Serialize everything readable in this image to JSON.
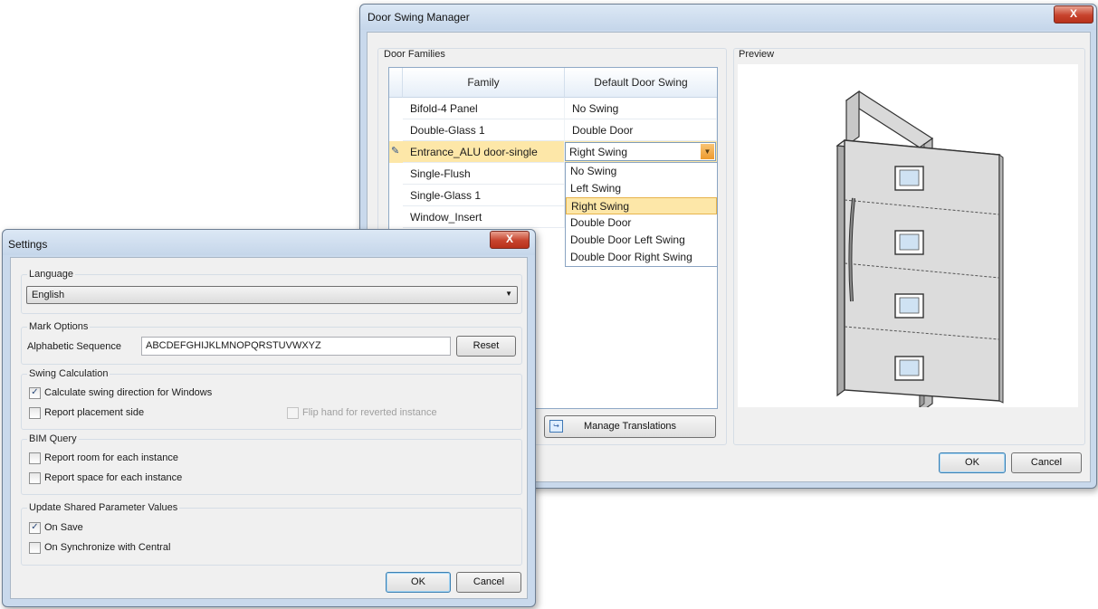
{
  "door_swing_manager": {
    "title": "Door Swing Manager",
    "close_label": "X",
    "door_families_label": "Door Families",
    "preview_label": "Preview",
    "columns": [
      "Family",
      "Default Door Swing"
    ],
    "rows": [
      {
        "family": "Bifold-4 Panel",
        "swing": "No Swing"
      },
      {
        "family": "Double-Glass 1",
        "swing": "Double Door"
      },
      {
        "family": "Entrance_ALU door-single",
        "swing": "Right Swing",
        "editing": true
      },
      {
        "family": "Single-Flush",
        "swing": ""
      },
      {
        "family": "Single-Glass 1",
        "swing": ""
      },
      {
        "family": "Window_Insert",
        "swing": ""
      }
    ],
    "swing_options": [
      "No Swing",
      "Left Swing",
      "Right Swing",
      "Double Door",
      "Double Door Left Swing",
      "Double Door Right Swing"
    ],
    "selected_option": "Right Swing",
    "manage_translations_label": "Manage Translations",
    "ok_label": "OK",
    "cancel_label": "Cancel"
  },
  "settings": {
    "title": "Settings",
    "close_label": "X",
    "language": {
      "label": "Language",
      "value": "English"
    },
    "mark_options": {
      "label": "Mark Options",
      "sequence_label": "Alphabetic Sequence",
      "sequence_value": "ABCDEFGHIJKLMNOPQRSTUVWXYZ",
      "reset_label": "Reset"
    },
    "swing_calculation": {
      "label": "Swing Calculation",
      "calc_windows": {
        "label": "Calculate swing direction for Windows",
        "checked": true
      },
      "report_side": {
        "label": "Report placement side",
        "checked": false
      },
      "flip_hand": {
        "label": "Flip hand for reverted instance",
        "checked": false,
        "enabled": false
      }
    },
    "bim_query": {
      "label": "BIM Query",
      "report_room": {
        "label": "Report room for each instance",
        "checked": false
      },
      "report_space": {
        "label": "Report space for each instance",
        "checked": false
      }
    },
    "shared_params": {
      "label": "Update Shared Parameter Values",
      "on_save": {
        "label": "On Save",
        "checked": true
      },
      "on_sync": {
        "label": "On Synchronize with Central",
        "checked": false
      }
    },
    "ok_label": "OK",
    "cancel_label": "Cancel"
  },
  "colors": {
    "title_bar": "#c5d6ea",
    "close_button": "#c7432d",
    "selected_row": "#fde7a8",
    "combo_arrow": "#f0a23c"
  },
  "icons": {
    "row_edit": "pencil-icon",
    "combo": "chevron-down-icon",
    "translations": "translate-icon"
  }
}
